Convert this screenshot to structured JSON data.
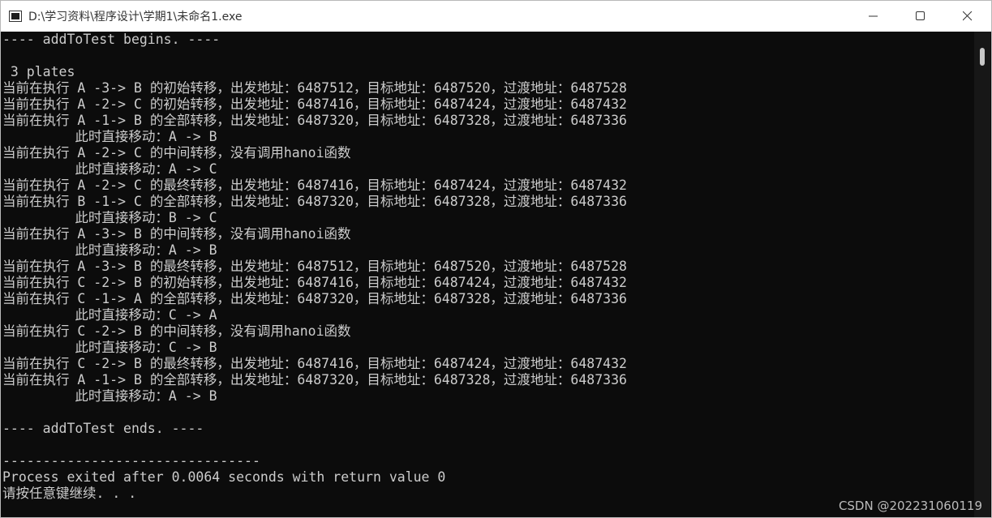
{
  "window": {
    "title": "D:\\学习资料\\程序设计\\学期1\\未命名1.exe"
  },
  "console": {
    "lines": [
      "---- addToTest begins. ----",
      "",
      " 3 plates",
      "当前在执行 A -3-> B 的初始转移，出发地址：6487512，目标地址：6487520，过渡地址：6487528",
      "当前在执行 A -2-> C 的初始转移，出发地址：6487416，目标地址：6487424，过渡地址：6487432",
      "当前在执行 A -1-> B 的全部转移，出发地址：6487320，目标地址：6487328，过渡地址：6487336",
      "         此时直接移动：A -> B",
      "当前在执行 A -2-> C 的中间转移，没有调用hanoi函数",
      "         此时直接移动：A -> C",
      "当前在执行 A -2-> C 的最终转移，出发地址：6487416，目标地址：6487424，过渡地址：6487432",
      "当前在执行 B -1-> C 的全部转移，出发地址：6487320，目标地址：6487328，过渡地址：6487336",
      "         此时直接移动：B -> C",
      "当前在执行 A -3-> B 的中间转移，没有调用hanoi函数",
      "         此时直接移动：A -> B",
      "当前在执行 A -3-> B 的最终转移，出发地址：6487512，目标地址：6487520，过渡地址：6487528",
      "当前在执行 C -2-> B 的初始转移，出发地址：6487416，目标地址：6487424，过渡地址：6487432",
      "当前在执行 C -1-> A 的全部转移，出发地址：6487320，目标地址：6487328，过渡地址：6487336",
      "         此时直接移动：C -> A",
      "当前在执行 C -2-> B 的中间转移，没有调用hanoi函数",
      "         此时直接移动：C -> B",
      "当前在执行 C -2-> B 的最终转移，出发地址：6487416，目标地址：6487424，过渡地址：6487432",
      "当前在执行 A -1-> B 的全部转移，出发地址：6487320，目标地址：6487328，过渡地址：6487336",
      "         此时直接移动：A -> B",
      "",
      "---- addToTest ends. ----",
      "",
      "--------------------------------",
      "Process exited after 0.0064 seconds with return value 0",
      "请按任意键继续. . ."
    ]
  },
  "watermark": "CSDN @202231060119",
  "colors": {
    "console_bg": "#0c0c0c",
    "console_text": "#cccccc",
    "titlebar_bg": "#ffffff"
  },
  "icons": {
    "app": "console-app-icon",
    "minimize": "minimize-icon",
    "maximize": "maximize-icon",
    "close": "close-icon"
  }
}
